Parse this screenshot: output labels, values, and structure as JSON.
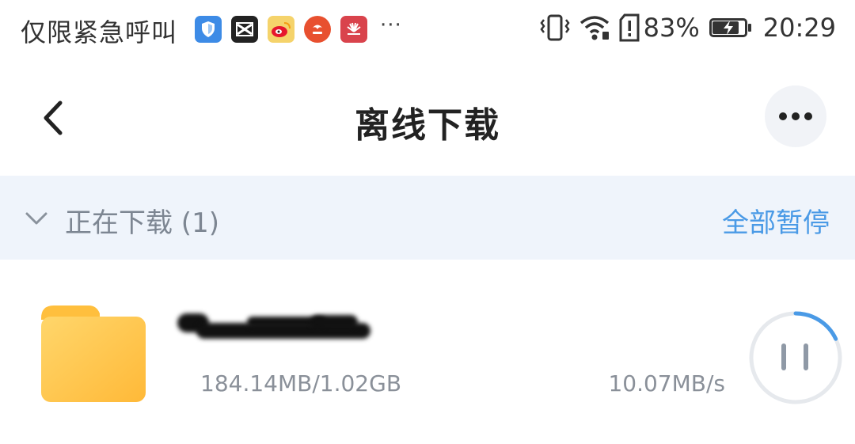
{
  "status_bar": {
    "carrier_text": "仅限紧急呼叫",
    "more_notifications": "···",
    "battery_percent": "83%",
    "time": "20:29",
    "battery_level": 0.83,
    "notification_icons": [
      "shield-app-icon",
      "capcut-icon",
      "weibo-icon",
      "jd-icon",
      "huawei-icon"
    ],
    "system_icons": [
      "vibrate-icon",
      "wifi-icon",
      "sim-alert-icon",
      "battery-charging-icon"
    ]
  },
  "header": {
    "title": "离线下载",
    "back_icon": "chevron-left-icon",
    "more_icon": "more-horizontal-icon"
  },
  "section": {
    "title": "正在下载 (1)",
    "pause_all_label": "全部暂停",
    "collapse_icon": "chevron-down-icon"
  },
  "download": {
    "name": "",
    "size_progress": "184.14MB/1.02GB",
    "speed": "10.07MB/s",
    "progress": 0.18,
    "icon": "folder-icon",
    "action_icon": "pause-icon"
  },
  "colors": {
    "accent": "#4a9ae6",
    "section_bg": "#eff4fb",
    "folder": "#ffc94d",
    "muted_text": "#8a9099"
  }
}
